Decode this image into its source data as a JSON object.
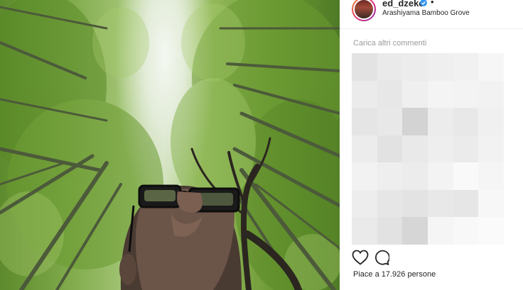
{
  "header": {
    "username": "ed_dzeko",
    "location": "Arashiyama Bamboo Grove",
    "separator": "•"
  },
  "comments": {
    "load_more_label": "Carica altri commenti",
    "blurred_cells": [
      "#e3e3e3",
      "#eaeaea",
      "#ececec",
      "#efefef",
      "#f1f1f1",
      "#f6f6f6",
      "#ebebeb",
      "#e7e7e7",
      "#efefef",
      "#f4f4f4",
      "#f3f3f3",
      "#f2f2f2",
      "#e5e5e5",
      "#e8e8e8",
      "#d3d3d3",
      "#ececec",
      "#e8e8e8",
      "#f0f0f0",
      "#ececec",
      "#e2e2e2",
      "#e9e9e9",
      "#eeeeee",
      "#ebebeb",
      "#f2f2f2",
      "#f2f2f2",
      "#eeeeee",
      "#ececec",
      "#f3f3f3",
      "#f9f9f9",
      "#f5f5f5",
      "#ededed",
      "#e6e6e6",
      "#e3e3e3",
      "#e8e8e8",
      "#e6e6e6",
      "#f7f7f7",
      "#eaeaea",
      "#e2e2e2",
      "#d6d6d6",
      "#f5f5f5",
      "#f8f8f8",
      "#fafafa"
    ]
  },
  "actions": {
    "like_icon": "heart-icon",
    "comment_icon": "comment-icon",
    "likes_text": "Piace a 17.926 persone"
  },
  "colors": {
    "text": "#262626",
    "muted": "#999999",
    "verified": "#3897f0"
  }
}
